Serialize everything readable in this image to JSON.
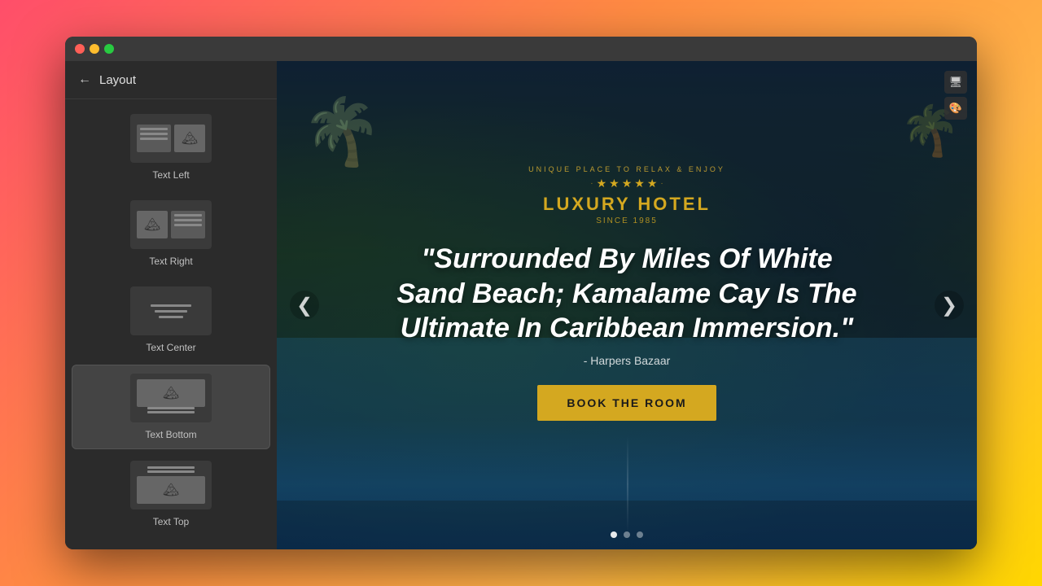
{
  "window": {
    "dots": [
      "red",
      "yellow",
      "green"
    ]
  },
  "sidebar": {
    "title": "Layout",
    "back_label": "←",
    "items": [
      {
        "id": "text-left",
        "label": "Text Left",
        "active": false
      },
      {
        "id": "text-right",
        "label": "Text Right",
        "active": false
      },
      {
        "id": "text-center",
        "label": "Text Center",
        "active": false
      },
      {
        "id": "text-bottom",
        "label": "Text Bottom",
        "active": true
      },
      {
        "id": "text-top",
        "label": "Text Top",
        "active": false
      }
    ]
  },
  "hero": {
    "logo": {
      "tagline": "UNIQUE PLACE TO RELAX & ENJOY",
      "name": "LUXURY HOTEL",
      "since": "Since 1985",
      "stars_count": 5
    },
    "quote": "\"Surrounded By Miles Of White Sand Beach; Kamalame Cay Is The Ultimate In Caribbean Immersion.\"",
    "attribution": "- Harpers Bazaar",
    "book_button": "BOOK THE ROOM"
  },
  "toolbar": {
    "icons": [
      "monitor-icon",
      "paint-icon"
    ]
  },
  "carousel": {
    "dots": [
      true,
      false,
      false
    ],
    "prev_label": "❮",
    "next_label": "❯"
  }
}
